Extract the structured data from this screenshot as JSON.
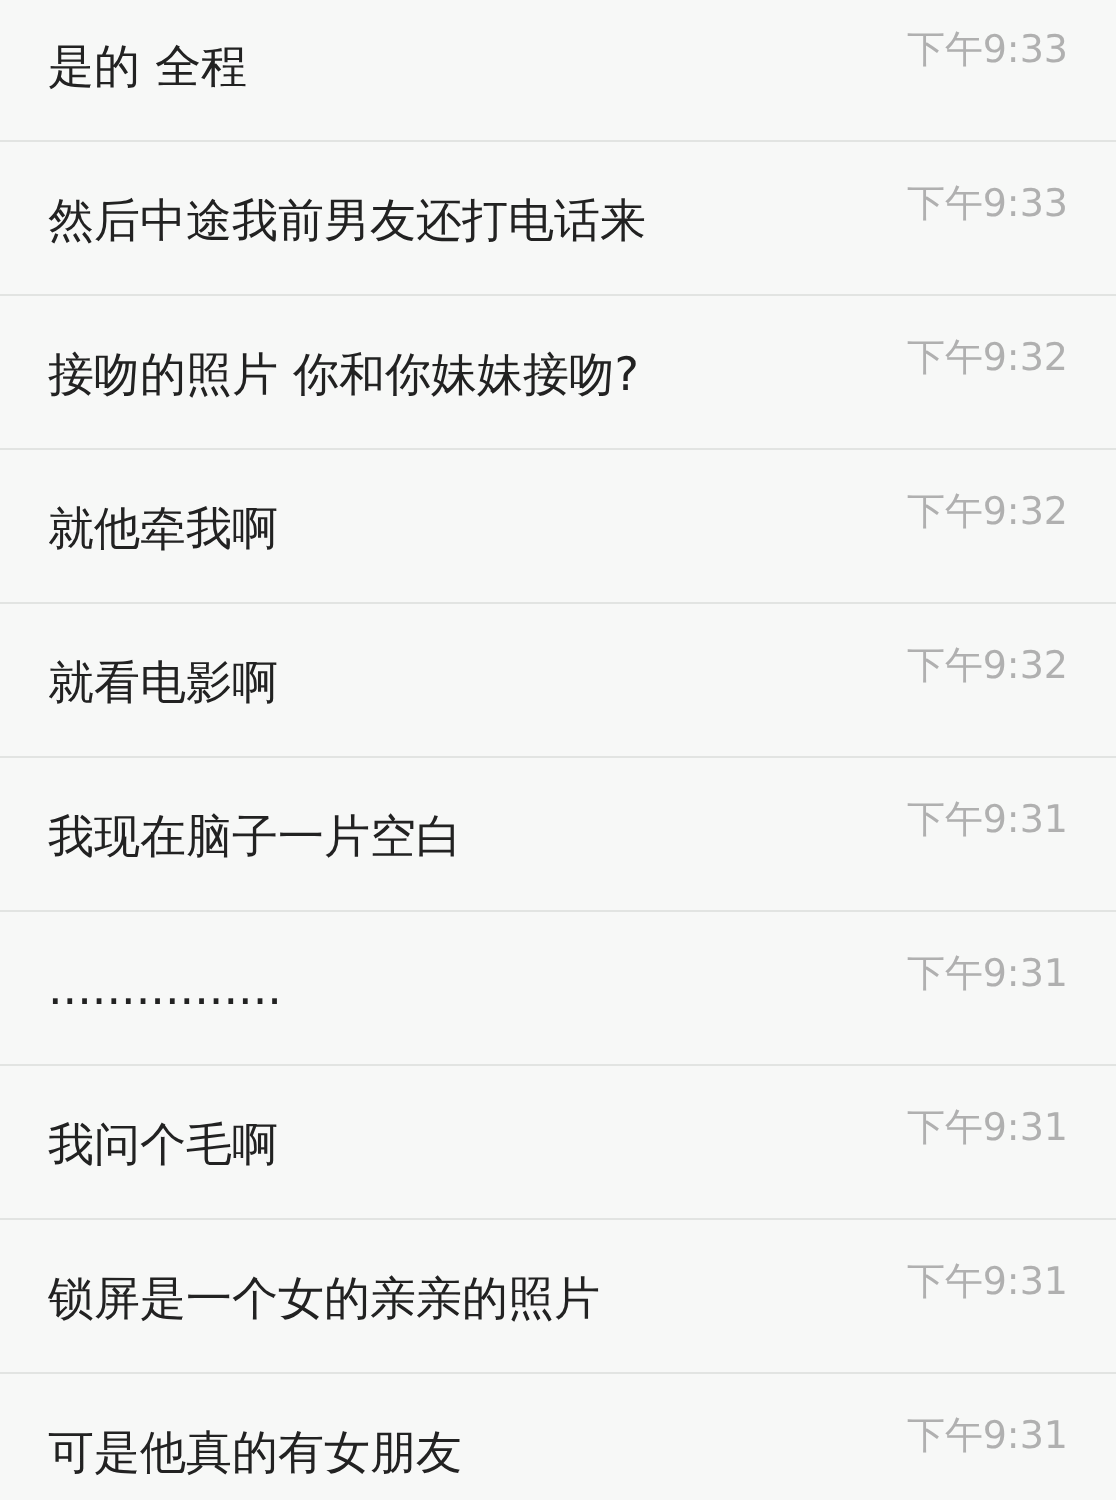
{
  "messages": [
    {
      "text": "是的 全程",
      "time": "下午9:33"
    },
    {
      "text": "然后中途我前男友还打电话来",
      "time": "下午9:33"
    },
    {
      "text": "接吻的照片 你和你妹妹接吻?",
      "time": "下午9:32"
    },
    {
      "text": "就他牵我啊",
      "time": "下午9:32"
    },
    {
      "text": "就看电影啊",
      "time": "下午9:32"
    },
    {
      "text": "我现在脑子一片空白",
      "time": "下午9:31"
    },
    {
      "text": "................",
      "time": "下午9:31"
    },
    {
      "text": "我问个毛啊",
      "time": "下午9:31"
    },
    {
      "text": "锁屏是一个女的亲亲的照片",
      "time": "下午9:31"
    },
    {
      "text": "可是他真的有女朋友",
      "time": "下午9:31"
    }
  ]
}
